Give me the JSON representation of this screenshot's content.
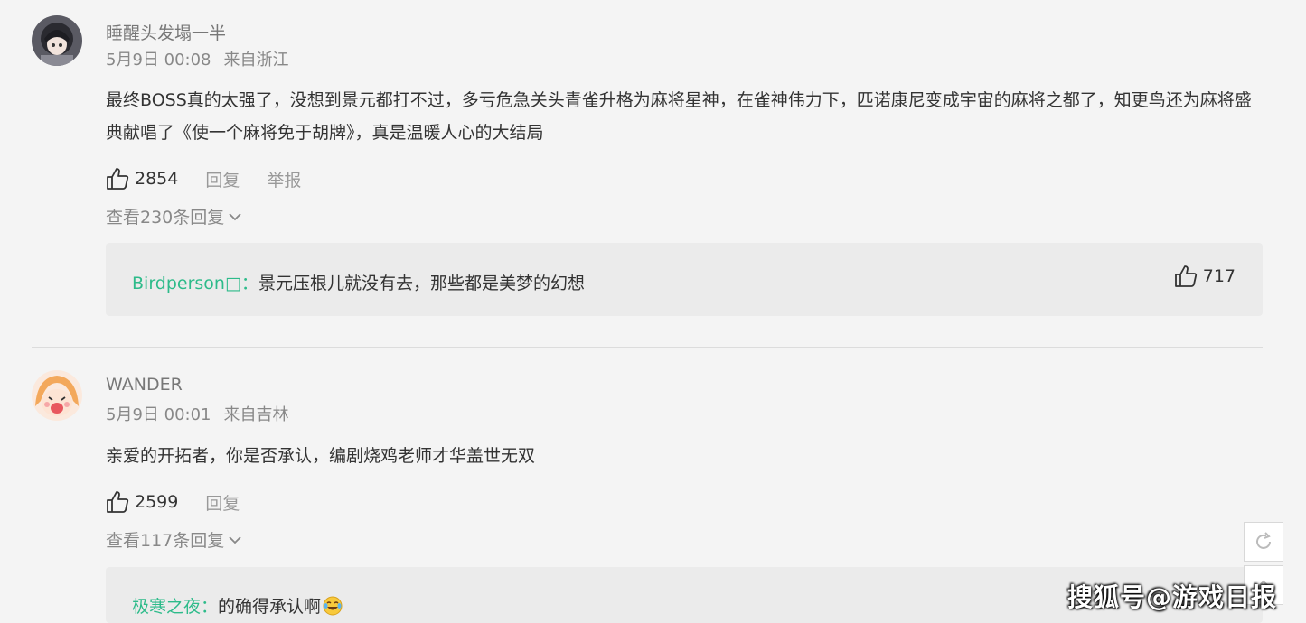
{
  "comments": [
    {
      "username": "睡醒头发塌一半",
      "date": "5月9日 00:08",
      "location": "来自浙江",
      "content": "最终BOSS真的太强了，没想到景元都打不过，多亏危急关头青雀升格为麻将星神，在雀神伟力下，匹诺康尼变成宇宙的麻将之都了，知更鸟还为麻将盛典献唱了《使一个麻将免于胡牌》，真是温暖人心的大结局",
      "likes": "2854",
      "reply_label": "回复",
      "report_label": "举报",
      "view_replies": "查看230条回复",
      "top_reply": {
        "user": "Birdperson□：",
        "text": "景元压根儿就没有去，那些都是美梦的幻想",
        "likes": "717"
      }
    },
    {
      "username": "WANDER",
      "date": "5月9日 00:01",
      "location": "来自吉林",
      "content": "亲爱的开拓者，你是否承认，编剧烧鸡老师才华盖世无双",
      "likes": "2599",
      "reply_label": "回复",
      "view_replies": "查看117条回复",
      "top_reply": {
        "user": "极寒之夜：",
        "text": "的确得承认啊",
        "emoji": "laughing-tears"
      }
    }
  ],
  "watermark": "搜狐号@游戏日报",
  "floating_buttons": [
    "refresh-icon",
    "top-icon"
  ],
  "colors": {
    "reply_user": "#2dbb8a",
    "background": "#f4f4f4",
    "reply_box": "#ebebeb"
  }
}
